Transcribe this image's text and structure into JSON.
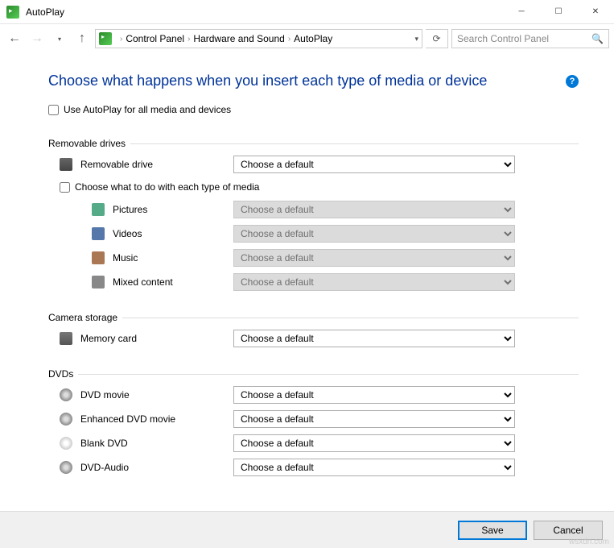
{
  "window": {
    "title": "AutoPlay"
  },
  "breadcrumb": {
    "items": [
      "Control Panel",
      "Hardware and Sound",
      "AutoPlay"
    ]
  },
  "search": {
    "placeholder": "Search Control Panel"
  },
  "page": {
    "title": "Choose what happens when you insert each type of media or device",
    "use_autoplay_label": "Use AutoPlay for all media and devices",
    "choose_media_label": "Choose what to do with each type of media",
    "default_option": "Choose a default"
  },
  "groups": {
    "removable": {
      "label": "Removable drives",
      "item": "Removable drive"
    },
    "media": {
      "pictures": "Pictures",
      "videos": "Videos",
      "music": "Music",
      "mixed": "Mixed content"
    },
    "camera": {
      "label": "Camera storage",
      "item": "Memory card"
    },
    "dvd": {
      "label": "DVDs",
      "movie": "DVD movie",
      "enhanced": "Enhanced DVD movie",
      "blank": "Blank DVD",
      "audio": "DVD-Audio"
    }
  },
  "footer": {
    "save": "Save",
    "cancel": "Cancel"
  },
  "watermark": "wsxdn.com"
}
